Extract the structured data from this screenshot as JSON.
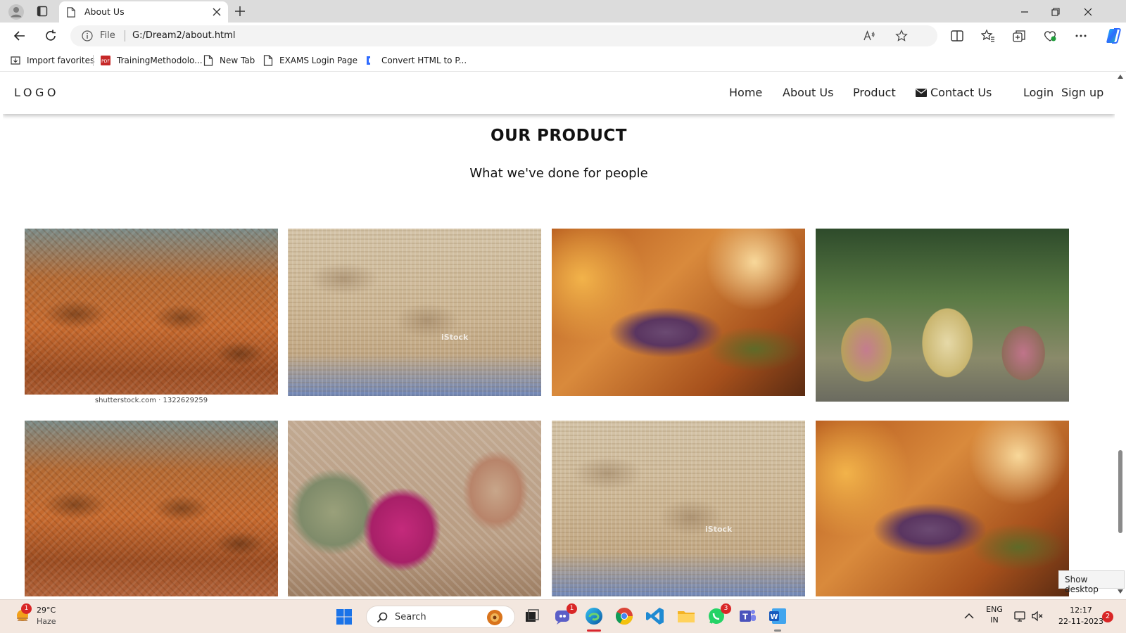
{
  "browser": {
    "tab_title": "About Us",
    "omnibox_scheme": "File",
    "omnibox_url": "G:/Dream2/about.html",
    "favorites": [
      {
        "label": "Import favorites",
        "icon": "import-icon"
      },
      {
        "label": "TrainingMethodolo...",
        "icon": "pdf-icon"
      },
      {
        "label": "New Tab",
        "icon": "page-icon"
      },
      {
        "label": "EXAMS Login Page",
        "icon": "page-icon"
      },
      {
        "label": "Convert HTML to P...",
        "icon": "convert-icon"
      }
    ]
  },
  "site": {
    "logo": "LOGO",
    "nav": [
      "Home",
      "About Us",
      "Product",
      "Contact Us",
      "Login",
      "Sign up"
    ],
    "section_title": "OUR PRODUCT",
    "section_subtitle": "What we've done for people",
    "photo_caption": "shutterstock.com · 1322629259",
    "watermark": "iStock",
    "photos": [
      {
        "name": "basket-photo-1",
        "style": "orange-cane-baskets"
      },
      {
        "name": "basket-photo-2",
        "style": "bamboo-bowls"
      },
      {
        "name": "basket-photo-3",
        "style": "woven-purse"
      },
      {
        "name": "basket-photo-4",
        "style": "woven-pots"
      },
      {
        "name": "basket-photo-5",
        "style": "orange-cane-baskets"
      },
      {
        "name": "basket-photo-6",
        "style": "pink-woven-baskets"
      },
      {
        "name": "basket-photo-7",
        "style": "bamboo-bowls"
      },
      {
        "name": "basket-photo-8",
        "style": "woven-purse"
      }
    ]
  },
  "tooltip": "Show desktop",
  "taskbar": {
    "weather_temp": "29°C",
    "weather_condition": "Haze",
    "weather_badge": "1",
    "search_placeholder": "Search",
    "teams_badge": "1",
    "whatsapp_badge": "3",
    "language": "ENG",
    "region": "IN",
    "time": "12:17",
    "date": "22-11-2023",
    "notification_count": "2"
  },
  "colors": {
    "taskbar_bg": "#f3e7df",
    "edge_blue": "#0078d4",
    "badge_red": "#d92626"
  }
}
